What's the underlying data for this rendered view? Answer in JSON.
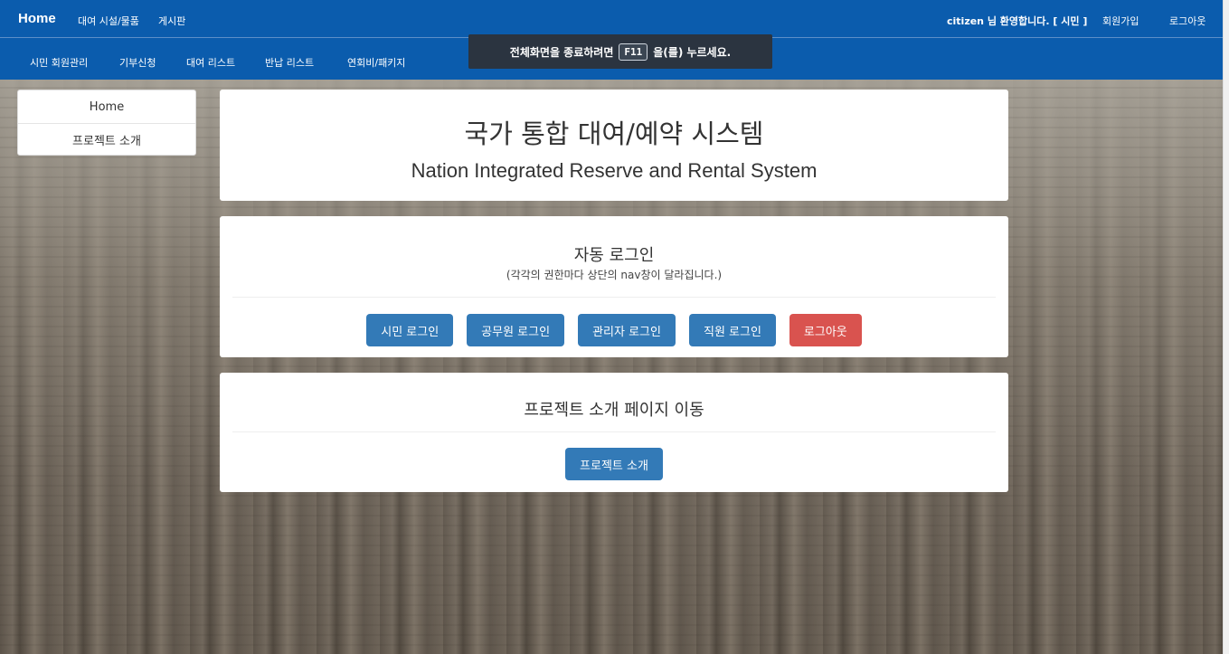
{
  "navbar": {
    "brand": "Home",
    "top_links": [
      "대여 시설/물품",
      "게시판"
    ],
    "sub_links": [
      "시민 회원관리",
      "기부신청",
      "대여 리스트",
      "반납 리스트",
      "연회비/패키지"
    ],
    "welcome": "citizen 님 환영합니다. [ 시민 ]",
    "signup": "회원가입",
    "logout": "로그아웃",
    "colors": {
      "bar": "#0b5cad"
    }
  },
  "fullscreen_banner": {
    "prefix": "전체화면을 종료하려면",
    "key": "F11",
    "suffix": "을(를) 누르세요."
  },
  "sidebar": {
    "items": [
      {
        "label": "Home"
      },
      {
        "label": "프로젝트 소개"
      }
    ]
  },
  "header_panel": {
    "title_ko": "국가 통합 대여/예약 시스템",
    "title_en": "Nation Integrated Reserve and Rental System"
  },
  "auto_login": {
    "heading": "자동 로그인",
    "subtitle": "(각각의 권한마다 상단의 nav창이 달라집니다.)",
    "buttons": [
      {
        "label": "시민 로그인",
        "color": "#337ab7"
      },
      {
        "label": "공무원 로그인",
        "color": "#337ab7"
      },
      {
        "label": "관리자 로그인",
        "color": "#337ab7"
      },
      {
        "label": "직원 로그인",
        "color": "#337ab7"
      },
      {
        "label": "로그아웃",
        "color": "#d9534f"
      }
    ]
  },
  "project": {
    "heading": "프로젝트 소개 페이지 이동",
    "button": "프로젝트 소개"
  }
}
